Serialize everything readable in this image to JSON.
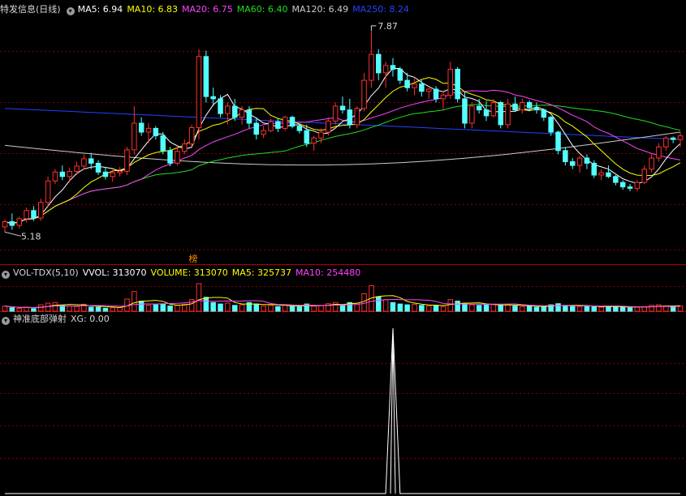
{
  "main_header": {
    "title": "特发信息(日线)",
    "ma_items": [
      {
        "label": "MA5: 6.94",
        "color": "#ffffff"
      },
      {
        "label": "MA10: 6.83",
        "color": "#ffff00"
      },
      {
        "label": "MA20: 6.75",
        "color": "#ff44ff"
      },
      {
        "label": "MA60: 6.40",
        "color": "#22dd22"
      },
      {
        "label": "MA120: 6.49",
        "color": "#cccccc"
      },
      {
        "label": "MA250: 8.24",
        "color": "#2244ff"
      }
    ]
  },
  "price_panel": {
    "high_label": "7.87",
    "low_label": "5.18",
    "badge": "榜"
  },
  "volume_header": {
    "title": "VOL-TDX(5,10)",
    "items": [
      {
        "label": "VVOL: 313070",
        "color": "#ffffff"
      },
      {
        "label": "VOLUME: 313070",
        "color": "#ffff00"
      },
      {
        "label": "MA5: 325737",
        "color": "#ffff00"
      },
      {
        "label": "MA10: 254480",
        "color": "#ff44ff"
      }
    ]
  },
  "signal_header": {
    "title": "神准底部弹射",
    "items": [
      {
        "label": "XG: 0.00",
        "color": "#d8d8d8"
      }
    ]
  },
  "colors": {
    "up": "#ff3030",
    "down": "#54ffff",
    "grid": "#8b0000",
    "ma5": "#ffffff",
    "ma10": "#ffff00",
    "ma20": "#ff44ff",
    "ma60": "#22dd22",
    "ma120": "#cccccc",
    "ma250": "#2244ff"
  },
  "chart_data": {
    "type": "candlestick",
    "y_range": [
      5.0,
      8.0
    ],
    "ohlc": [
      [
        5.22,
        5.32,
        5.15,
        5.29
      ],
      [
        5.29,
        5.4,
        5.18,
        5.24
      ],
      [
        5.24,
        5.36,
        5.2,
        5.33
      ],
      [
        5.33,
        5.48,
        5.28,
        5.44
      ],
      [
        5.44,
        5.5,
        5.3,
        5.34
      ],
      [
        5.34,
        5.6,
        5.3,
        5.55
      ],
      [
        5.55,
        5.9,
        5.5,
        5.84
      ],
      [
        5.84,
        6.0,
        5.8,
        5.96
      ],
      [
        5.96,
        6.05,
        5.85,
        5.9
      ],
      [
        5.9,
        6.02,
        5.82,
        5.97
      ],
      [
        5.97,
        6.1,
        5.92,
        6.04
      ],
      [
        6.04,
        6.2,
        6.0,
        6.14
      ],
      [
        6.14,
        6.22,
        6.0,
        6.08
      ],
      [
        6.08,
        6.12,
        5.92,
        5.96
      ],
      [
        5.96,
        6.02,
        5.86,
        5.9
      ],
      [
        5.9,
        5.99,
        5.83,
        5.95
      ],
      [
        5.95,
        6.03,
        5.9,
        5.97
      ],
      [
        5.97,
        6.3,
        5.92,
        6.26
      ],
      [
        6.26,
        6.85,
        6.2,
        6.62
      ],
      [
        6.62,
        6.7,
        6.45,
        6.5
      ],
      [
        6.5,
        6.62,
        6.35,
        6.55
      ],
      [
        6.55,
        6.58,
        6.4,
        6.45
      ],
      [
        6.45,
        6.5,
        6.2,
        6.25
      ],
      [
        6.25,
        6.3,
        6.04,
        6.08
      ],
      [
        6.08,
        6.3,
        6.05,
        6.24
      ],
      [
        6.24,
        6.4,
        6.2,
        6.34
      ],
      [
        6.34,
        6.6,
        6.3,
        6.56
      ],
      [
        6.56,
        7.62,
        6.4,
        7.52
      ],
      [
        7.52,
        7.6,
        6.9,
        6.98
      ],
      [
        6.98,
        7.1,
        6.85,
        6.95
      ],
      [
        6.95,
        7.0,
        6.7,
        6.75
      ],
      [
        6.75,
        6.9,
        6.6,
        6.85
      ],
      [
        6.85,
        6.95,
        6.65,
        6.7
      ],
      [
        6.7,
        6.85,
        6.6,
        6.8
      ],
      [
        6.8,
        6.85,
        6.55,
        6.62
      ],
      [
        6.62,
        6.7,
        6.4,
        6.47
      ],
      [
        6.47,
        6.58,
        6.42,
        6.52
      ],
      [
        6.52,
        6.68,
        6.5,
        6.64
      ],
      [
        6.64,
        6.68,
        6.5,
        6.55
      ],
      [
        6.55,
        6.72,
        6.52,
        6.7
      ],
      [
        6.7,
        6.72,
        6.55,
        6.58
      ],
      [
        6.58,
        6.62,
        6.48,
        6.52
      ],
      [
        6.52,
        6.6,
        6.3,
        6.35
      ],
      [
        6.35,
        6.45,
        6.25,
        6.42
      ],
      [
        6.42,
        6.55,
        6.35,
        6.5
      ],
      [
        6.5,
        6.7,
        6.45,
        6.65
      ],
      [
        6.65,
        6.9,
        6.6,
        6.85
      ],
      [
        6.85,
        6.98,
        6.75,
        6.8
      ],
      [
        6.8,
        6.95,
        6.55,
        6.6
      ],
      [
        6.6,
        6.85,
        6.55,
        6.82
      ],
      [
        6.82,
        7.3,
        6.78,
        7.2
      ],
      [
        7.2,
        7.87,
        7.1,
        7.55
      ],
      [
        7.55,
        7.62,
        7.2,
        7.3
      ],
      [
        7.3,
        7.45,
        7.1,
        7.4
      ],
      [
        7.4,
        7.5,
        7.25,
        7.35
      ],
      [
        7.35,
        7.38,
        7.15,
        7.2
      ],
      [
        7.2,
        7.3,
        7.05,
        7.1
      ],
      [
        7.1,
        7.22,
        7.0,
        7.15
      ],
      [
        7.15,
        7.2,
        6.98,
        7.05
      ],
      [
        7.05,
        7.1,
        6.95,
        7.08
      ],
      [
        7.08,
        7.12,
        6.9,
        6.95
      ],
      [
        6.95,
        7.05,
        6.8,
        7.0
      ],
      [
        7.0,
        7.45,
        6.95,
        7.35
      ],
      [
        7.35,
        7.38,
        6.9,
        6.95
      ],
      [
        6.95,
        7.05,
        6.55,
        6.62
      ],
      [
        6.62,
        6.9,
        6.55,
        6.85
      ],
      [
        6.85,
        6.95,
        6.75,
        6.8
      ],
      [
        6.8,
        6.92,
        6.65,
        6.72
      ],
      [
        6.72,
        6.95,
        6.7,
        6.9
      ],
      [
        6.9,
        6.92,
        6.55,
        6.6
      ],
      [
        6.6,
        6.95,
        6.55,
        6.88
      ],
      [
        6.88,
        6.98,
        6.78,
        6.8
      ],
      [
        6.8,
        6.95,
        6.75,
        6.9
      ],
      [
        6.9,
        6.93,
        6.78,
        6.83
      ],
      [
        6.83,
        6.9,
        6.75,
        6.8
      ],
      [
        6.8,
        6.82,
        6.65,
        6.7
      ],
      [
        6.7,
        6.72,
        6.45,
        6.5
      ],
      [
        6.5,
        6.52,
        6.2,
        6.25
      ],
      [
        6.25,
        6.3,
        6.05,
        6.1
      ],
      [
        6.1,
        6.15,
        6.0,
        6.05
      ],
      [
        6.05,
        6.18,
        5.95,
        6.15
      ],
      [
        6.15,
        6.2,
        6.0,
        6.08
      ],
      [
        6.08,
        6.12,
        5.88,
        5.92
      ],
      [
        5.92,
        6.0,
        5.85,
        5.95
      ],
      [
        5.95,
        6.05,
        5.88,
        5.9
      ],
      [
        5.9,
        5.92,
        5.78,
        5.82
      ],
      [
        5.82,
        5.85,
        5.72,
        5.76
      ],
      [
        5.76,
        5.8,
        5.7,
        5.74
      ],
      [
        5.74,
        5.85,
        5.7,
        5.82
      ],
      [
        5.82,
        6.05,
        5.8,
        6.0
      ],
      [
        6.0,
        6.2,
        5.95,
        6.15
      ],
      [
        6.15,
        6.35,
        6.1,
        6.3
      ],
      [
        6.3,
        6.45,
        6.25,
        6.42
      ],
      [
        6.42,
        6.44,
        6.35,
        6.4
      ],
      [
        6.4,
        6.5,
        6.3,
        6.45
      ]
    ],
    "ma_flat": [
      {
        "name": "MA250",
        "start": 6.82,
        "end": 6.4
      },
      {
        "name": "MA120",
        "start": 6.2,
        "end": 6.38
      }
    ],
    "volume": [
      18,
      12,
      10,
      14,
      9,
      22,
      28,
      30,
      20,
      18,
      16,
      24,
      14,
      14,
      10,
      12,
      13,
      42,
      68,
      35,
      20,
      22,
      25,
      18,
      20,
      24,
      40,
      95,
      48,
      30,
      25,
      28,
      20,
      22,
      30,
      25,
      18,
      20,
      16,
      22,
      18,
      15,
      25,
      18,
      20,
      26,
      30,
      22,
      30,
      28,
      60,
      88,
      50,
      40,
      30,
      25,
      22,
      24,
      20,
      18,
      20,
      16,
      40,
      35,
      28,
      22,
      20,
      22,
      24,
      20,
      22,
      18,
      16,
      18,
      14,
      16,
      22,
      26,
      20,
      18,
      16,
      18,
      15,
      14,
      16,
      18,
      14,
      12,
      14,
      16,
      20,
      22,
      18,
      16,
      18
    ],
    "signal": {
      "index": 54,
      "value": 1
    }
  }
}
